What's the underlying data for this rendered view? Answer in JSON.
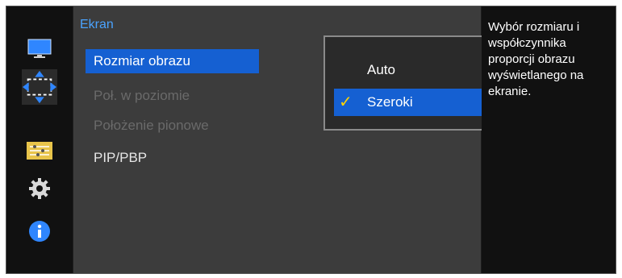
{
  "menu": {
    "title": "Ekran",
    "items": [
      {
        "label": "Rozmiar obrazu",
        "state": "selected"
      },
      {
        "label": "Poł. w poziomie",
        "state": "disabled"
      },
      {
        "label": "Położenie pionowe",
        "state": "disabled"
      },
      {
        "label": "PIP/PBP",
        "state": "normal",
        "has_submenu": true
      }
    ]
  },
  "popup": {
    "options": [
      {
        "label": "Auto",
        "selected": false
      },
      {
        "label": "Szeroki",
        "selected": true
      }
    ]
  },
  "description": "Wybór rozmiaru i współczynnika proporcji obrazu wyświetlanego na ekranie.",
  "icons": [
    "monitor-icon",
    "picture-size-icon",
    "settings-list-icon",
    "gear-icon",
    "info-icon"
  ],
  "colors": {
    "accent_blue": "#1560d2",
    "title_blue": "#4aa3ff",
    "check_yellow": "#ffd400",
    "panel": "#3c3c3c",
    "background": "#111111"
  }
}
